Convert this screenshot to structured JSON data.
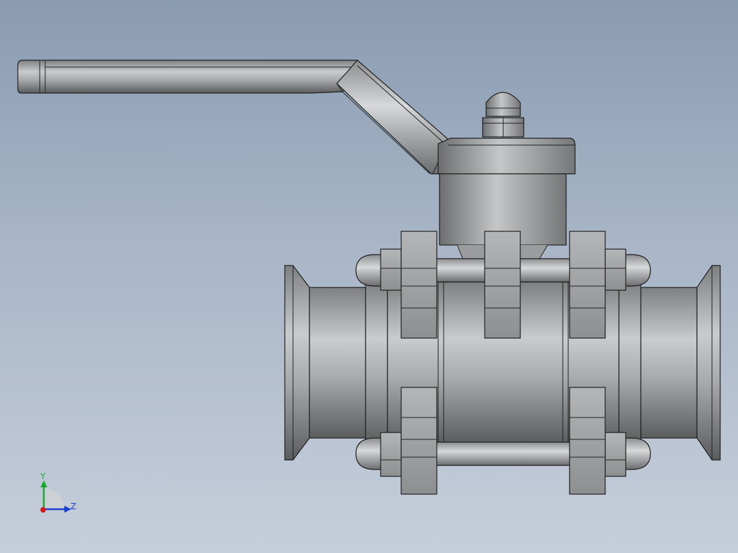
{
  "viewport": {
    "background_top": "#8a9bb1",
    "background_bottom": "#c6ceda"
  },
  "model": {
    "metal_light": "#d2d4d6",
    "metal_mid": "#9fa1a3",
    "metal_dark": "#5f6163",
    "edge_color": "#1e1e1e"
  },
  "triad": {
    "y_label": "Y",
    "z_label": "Z",
    "y_color": "#18a830",
    "z_color": "#1a3fd0",
    "x_color": "#d21a1a"
  }
}
